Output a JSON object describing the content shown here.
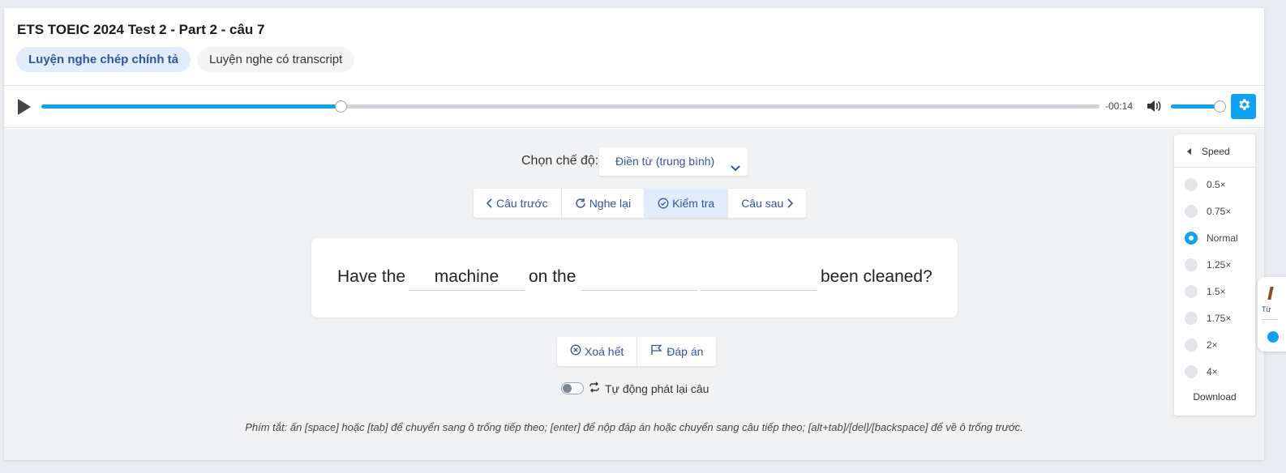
{
  "header": {
    "title": "ETS TOEIC 2024 Test 2 - Part 2 - câu 7",
    "tabs": [
      {
        "label": "Luyện nghe chép chính tả",
        "active": true
      },
      {
        "label": "Luyện nghe có transcript",
        "active": false
      }
    ]
  },
  "player": {
    "remaining_time": "-00:14",
    "progress_fraction": 0.283,
    "volume_fraction": 1.0,
    "accent_color": "#0da3f2"
  },
  "mode": {
    "label": "Chọn chế độ:",
    "selected": "Điền từ (trung bình)"
  },
  "nav_buttons": {
    "prev": "Câu trước",
    "replay": "Nghe lại",
    "check": "Kiểm tra",
    "next": "Câu sau"
  },
  "sentence": {
    "word1": "Have the",
    "blank1": "machine",
    "word2": "on the",
    "blank2": "",
    "blank3": "",
    "word3": "been cleaned?"
  },
  "actions": {
    "clear": "Xoá hết",
    "answer": "Đáp án"
  },
  "autoplay": {
    "label": "Tự động phát lại câu",
    "enabled": false
  },
  "hint": "Phím tắt: ấn [space] hoặc [tab] để chuyển sang ô trống tiếp theo; [enter] để nộp đáp án hoặc chuyển sang câu tiếp theo; [alt+tab]/[del]/[backspace] để về ô trống trước.",
  "speed_panel": {
    "title": "Speed",
    "options": [
      "0.5×",
      "0.75×",
      "Normal",
      "1.25×",
      "1.5×",
      "1.75×",
      "2×",
      "4×"
    ],
    "selected": "Normal",
    "download": "Download"
  },
  "side_widget": {
    "text": "Từ"
  }
}
